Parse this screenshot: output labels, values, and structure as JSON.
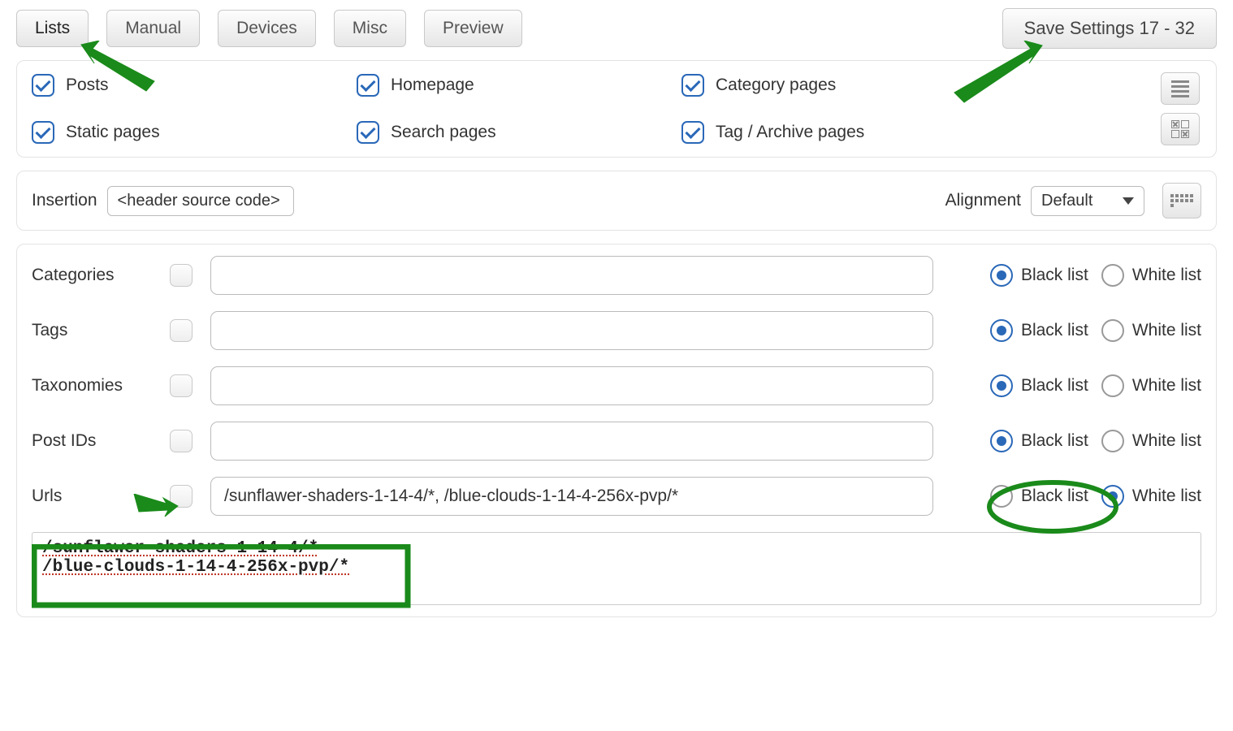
{
  "tabs": {
    "lists": "Lists",
    "manual": "Manual",
    "devices": "Devices",
    "misc": "Misc",
    "preview": "Preview"
  },
  "save_button": "Save Settings 17 - 32",
  "page_types": {
    "posts": "Posts",
    "homepage": "Homepage",
    "category": "Category pages",
    "static": "Static pages",
    "search": "Search pages",
    "tag": "Tag / Archive pages"
  },
  "insertion": {
    "label": "Insertion",
    "value": "<header source code>"
  },
  "alignment": {
    "label": "Alignment",
    "value": "Default"
  },
  "radio_labels": {
    "black": "Black list",
    "white": "White list"
  },
  "rows": {
    "categories": {
      "label": "Categories",
      "value": "",
      "selected": "black"
    },
    "tags": {
      "label": "Tags",
      "value": "",
      "selected": "black"
    },
    "taxonomies": {
      "label": "Taxonomies",
      "value": "",
      "selected": "black"
    },
    "postids": {
      "label": "Post IDs",
      "value": "",
      "selected": "black"
    },
    "urls": {
      "label": "Urls",
      "value": "/sunflawer-shaders-1-14-4/*, /blue-clouds-1-14-4-256x-pvp/*",
      "selected": "white"
    }
  },
  "url_expanded": {
    "line1": "/sunflawer-shaders-1-14-4/*",
    "line2": "/blue-clouds-1-14-4-256x-pvp/*"
  }
}
